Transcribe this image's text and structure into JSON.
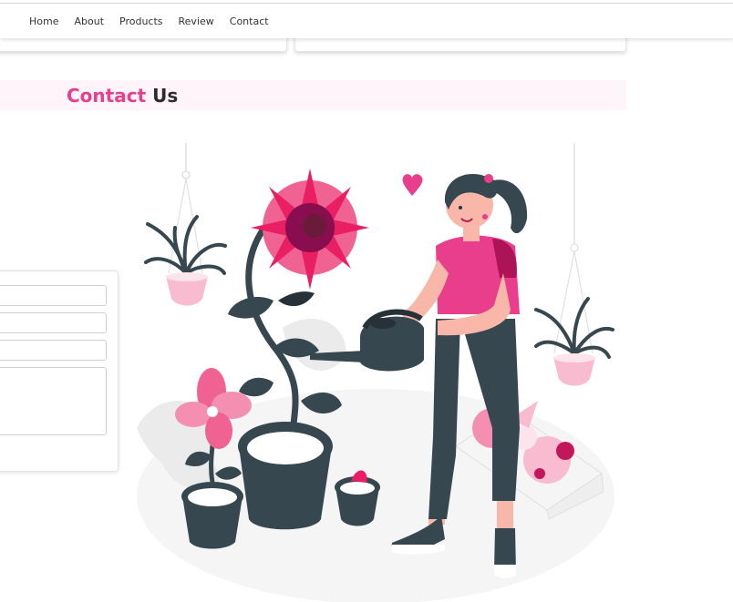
{
  "nav": {
    "items": [
      "Home",
      "About",
      "Products",
      "Review",
      "Contact"
    ]
  },
  "contact": {
    "title_accent": "Contact",
    "title_rest": " Us"
  },
  "colors": {
    "accent": "#e83e8c",
    "dark": "#37474f",
    "band": "#fff4fa"
  }
}
